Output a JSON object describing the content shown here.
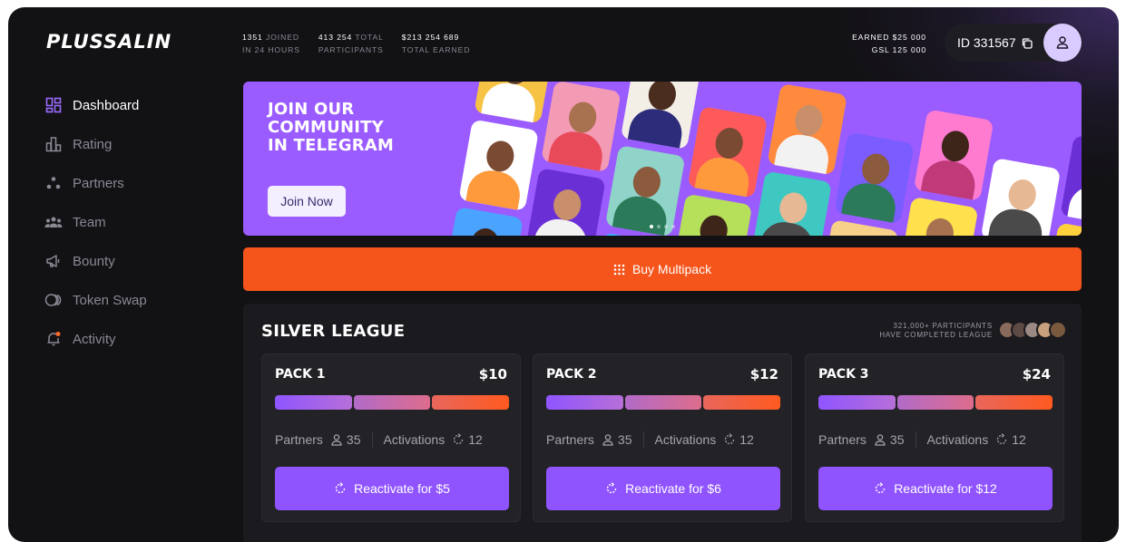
{
  "brand": {
    "logo_text": "PLUSSALIN"
  },
  "header": {
    "stats": [
      {
        "value": "1351",
        "label_inline": "JOINED",
        "label_line2": "IN 24 HOURS"
      },
      {
        "value": "413 254",
        "label_inline": "TOTAL",
        "label_line2": "PARTICIPANTS"
      },
      {
        "value": "$213 254 689",
        "label_inline": "",
        "label_line2": "TOTAL EARNED"
      }
    ],
    "earned": "EARNED $25 000",
    "gsl": "GSL 125 000",
    "user_id": "ID 331567"
  },
  "sidebar": {
    "items": [
      {
        "label": "Dashboard",
        "icon": "dashboard-icon",
        "active": true
      },
      {
        "label": "Rating",
        "icon": "rating-icon",
        "active": false
      },
      {
        "label": "Partners",
        "icon": "partners-icon",
        "active": false
      },
      {
        "label": "Team",
        "icon": "team-icon",
        "active": false
      },
      {
        "label": "Bounty",
        "icon": "megaphone-icon",
        "active": false
      },
      {
        "label": "Token Swap",
        "icon": "swap-icon",
        "active": false
      },
      {
        "label": "Activity",
        "icon": "bell-icon",
        "active": false
      }
    ]
  },
  "banner": {
    "title_line1": "JOIN OUR",
    "title_line2": "COMMUNITY",
    "title_line3": "IN TELEGRAM",
    "button": "Join Now"
  },
  "multipack": {
    "label": "Buy Multipack"
  },
  "league": {
    "title": "SILVER LEAGUE",
    "completed_line1": "321,000+ PARTICIPANTS",
    "completed_line2": "HAVE COMPLETED LEAGUE",
    "packs": [
      {
        "name": "PACK 1",
        "price": "$10",
        "partners_label": "Partners",
        "partners": "35",
        "activations_label": "Activations",
        "activations": "12",
        "button": "Reactivate for $5"
      },
      {
        "name": "PACK 2",
        "price": "$12",
        "partners_label": "Partners",
        "partners": "35",
        "activations_label": "Activations",
        "activations": "12",
        "button": "Reactivate for $6"
      },
      {
        "name": "PACK 3",
        "price": "$24",
        "partners_label": "Partners",
        "partners": "35",
        "activations_label": "Activations",
        "activations": "12",
        "button": "Reactivate for $12"
      }
    ]
  },
  "colors": {
    "accent": "#9054ff",
    "orange": "#f5541b",
    "background": "#121114",
    "banner": "#9b5cff"
  }
}
